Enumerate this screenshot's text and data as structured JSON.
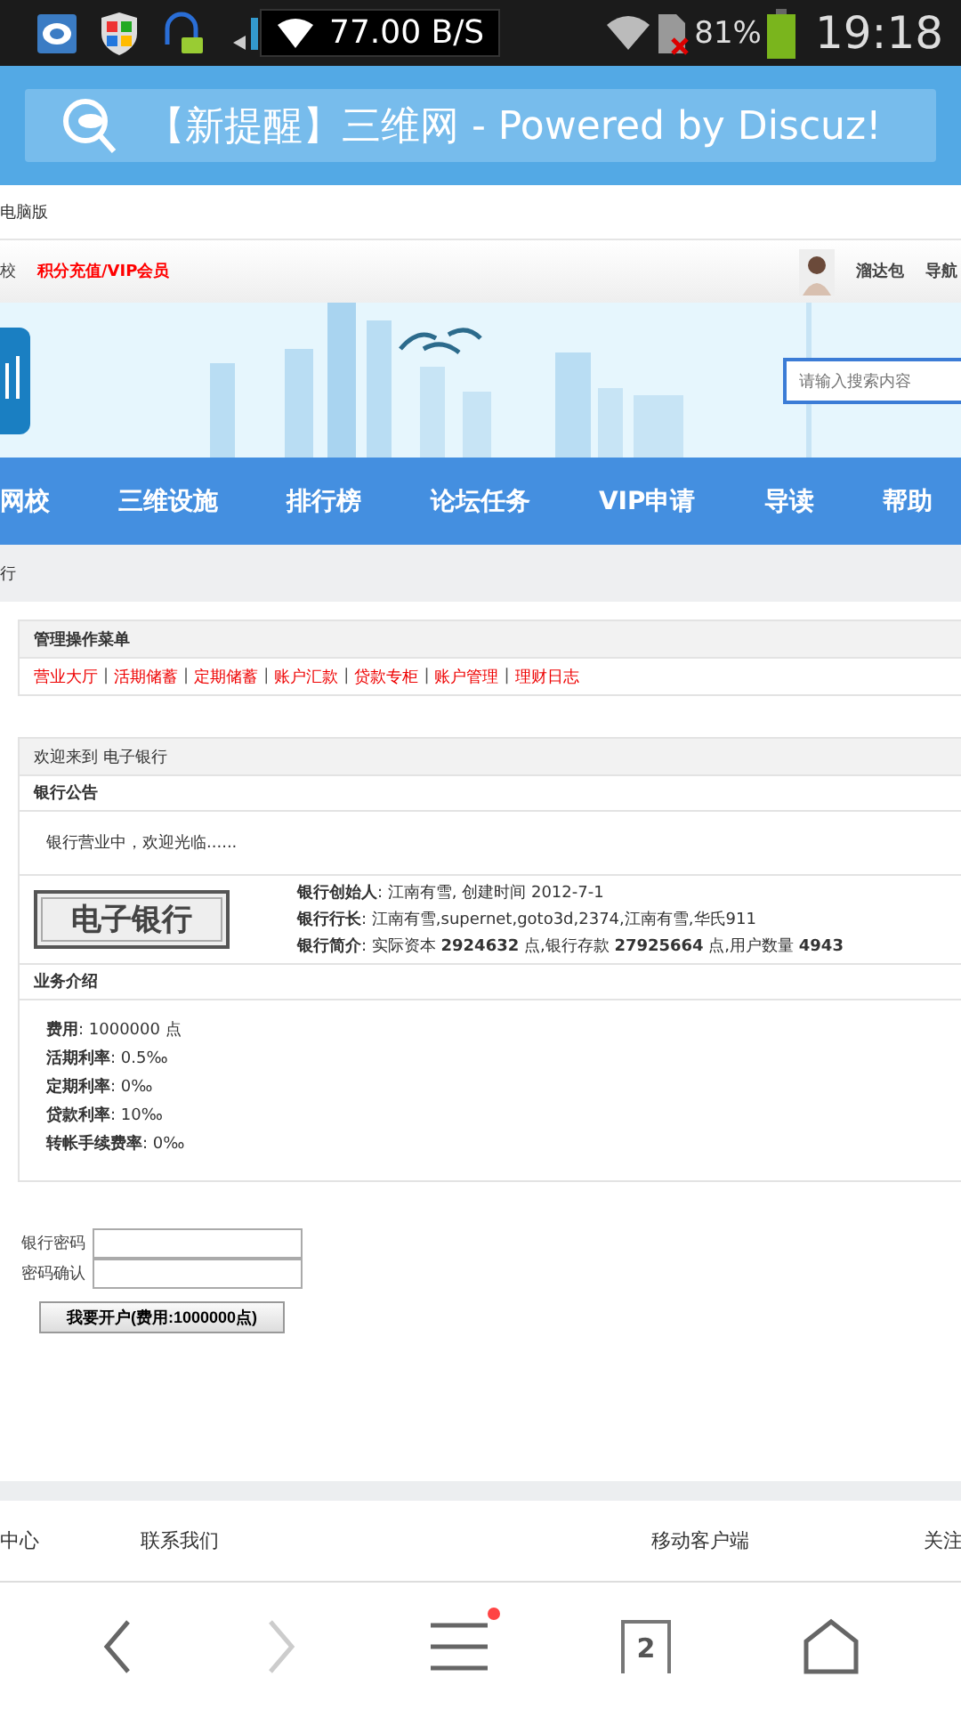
{
  "status_bar": {
    "speed": "77.00 B/S",
    "battery": "81%",
    "time": "19:18"
  },
  "browser": {
    "title": "【新提醒】三维网 - Powered by Discuz!"
  },
  "site": {
    "mobile_link": "电脑版",
    "top_links": [
      {
        "label": "校",
        "color": "#444444"
      },
      {
        "label": "积分充值/VIP会员",
        "color": "#ff0000"
      },
      {
        "label": "溜达包",
        "color": "#444444"
      },
      {
        "label": "导航",
        "color": "#444444"
      }
    ],
    "search": {
      "placeholder": "请输入搜索内容"
    },
    "nav": [
      "网校",
      "三维设施",
      "排行榜",
      "论坛任务",
      "VIP申请",
      "导读",
      "帮助"
    ],
    "breadcrumb": "行"
  },
  "menu": {
    "title": "管理操作菜单",
    "items": [
      {
        "label": "营业大厅"
      },
      {
        "separator": "|",
        "label": "活期储蓄"
      },
      {
        "separator": "|",
        "label": "定期储蓄"
      },
      {
        "separator": "|",
        "label": "账户汇款"
      },
      {
        "separator": "|",
        "label": "贷款专柜"
      },
      {
        "separator": "|",
        "label": "账户管理"
      },
      {
        "separator": "|",
        "label": "理财日志"
      }
    ]
  },
  "bank": {
    "title": "欢迎来到 电子银行",
    "notice_heading": "银行公告",
    "notice": "银行营业中，欢迎光临......",
    "logo_text": "电子银行",
    "info": [
      "**银行创始人**: 江南有雪, 创建时间 2012-7-1",
      "**银行行长**: 江南有雪,supernet,goto3d,2374,江南有雪,华氏911",
      "**银行简介**: 实际资本 **2924632** 点,银行存款 **27925664** 点,用户数量 **4943**"
    ],
    "intro_heading": "业务介绍",
    "intro": [
      "**费用**: 1000000 点",
      "**活期利率**: 0.5‰",
      "**定期利率**: 0‰",
      "**贷款利率**: 10‰",
      "**转帐手续费率**: 0‰"
    ]
  },
  "form": {
    "fields": [
      {
        "label": "银行密码"
      },
      {
        "label": "密码确认"
      }
    ],
    "button": "我要开户(费用:1000000点)"
  },
  "footer": [
    "中心",
    "联系我们",
    "移动客户端",
    "关注"
  ],
  "toolbar": [
    {
      "kind": "back",
      "disabled": false
    },
    {
      "kind": "forward",
      "disabled": true
    },
    {
      "kind": "menu",
      "badge": true
    },
    {
      "kind": "tabs",
      "count": "2"
    },
    {
      "kind": "home"
    }
  ]
}
